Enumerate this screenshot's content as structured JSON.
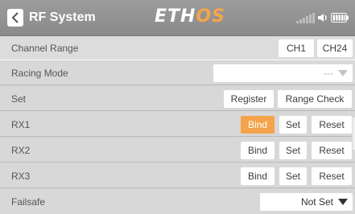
{
  "header": {
    "title": "RF System",
    "logo_main": "ETH",
    "logo_accent": "OS"
  },
  "rows": {
    "channel_range": {
      "label": "Channel Range",
      "start": "CH1",
      "end": "CH24"
    },
    "racing_mode": {
      "label": "Racing Mode",
      "value": "---"
    },
    "set": {
      "label": "Set",
      "register": "Register",
      "range_check": "Range Check"
    },
    "rx1": {
      "label": "RX1",
      "bind": "Bind",
      "set": "Set",
      "reset": "Reset"
    },
    "rx2": {
      "label": "RX2",
      "bind": "Bind",
      "set": "Set",
      "reset": "Reset"
    },
    "rx3": {
      "label": "RX3",
      "bind": "Bind",
      "set": "Set",
      "reset": "Reset"
    },
    "failsafe": {
      "label": "Failsafe",
      "value": "Not Set"
    }
  },
  "colors": {
    "accent": "#f4a34a",
    "header": "#929292",
    "row_bg": "#d8d8d8"
  },
  "icons": {
    "back": "chevron-left-icon",
    "signal": "signal-bars-icon",
    "speaker": "speaker-icon",
    "battery": "battery-icon",
    "dropdown": "triangle-down-icon"
  }
}
